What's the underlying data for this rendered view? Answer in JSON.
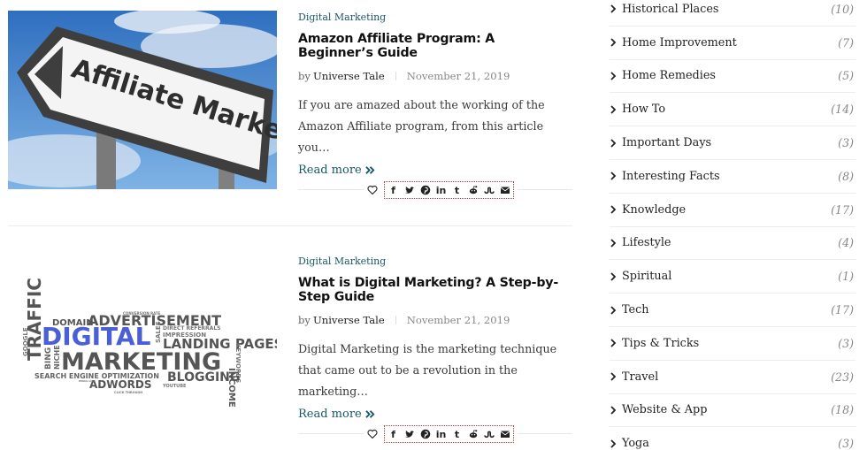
{
  "posts": [
    {
      "category": "Digital Marketing",
      "title": "Amazon Affiliate Program: A Beginner’s Guide",
      "by": "by",
      "author": "Universe Tale",
      "date": "November 21, 2019",
      "excerpt": "If you are amazed about the working of the Amazon Affiliate program, from this article you…",
      "read_more": "Read more",
      "image_sign_text": "Affiliate Marketing"
    },
    {
      "category": "Digital Marketing",
      "title": "What is Digital Marketing? A Step-by-Step Guide",
      "by": "by",
      "author": "Universe Tale",
      "date": "November 21, 2019",
      "excerpt": "Digital Marketing is the marketing technique that came out to be a revolution in the marketing…",
      "read_more": "Read more",
      "wordcloud": {
        "domain": "DOMAIN",
        "advertisement": "ADVERTISEMENT",
        "conversion_rate": "CONVERSION RATE",
        "traffic": "TRAFFIC",
        "digital": "DIGITAL",
        "sales": "SALES",
        "direct_referrals": "DIRECT REFERRALS",
        "impression": "IMPRESSION",
        "landing_pages": "LANDING PAGES",
        "google": "GOOGLE",
        "bing": "BING",
        "niche": "NICHE",
        "marketing": "MARKETING",
        "keywords": "KEYWORDS",
        "search_engine": "SEARCH ENGINE OPTIMIZATION",
        "blogging": "BLOGGING",
        "income": "INCOME",
        "adwords": "ADWORDS",
        "youtube": "YOUTUBE",
        "email_list": "EMAIL LIST",
        "click_through": "CLICK THROUGH"
      }
    }
  ],
  "share_icons": [
    "like-heart",
    "facebook",
    "twitter",
    "pinterest",
    "linkedin",
    "tumblr",
    "reddit",
    "stumbleupon",
    "email"
  ],
  "share_glyphs": {
    "facebook": "f",
    "linkedin": "in",
    "tumblr": "t"
  },
  "sidebar": {
    "categories": [
      {
        "label": "Historical Places",
        "count": "(10)"
      },
      {
        "label": "Home Improvement",
        "count": "(7)"
      },
      {
        "label": "Home Remedies",
        "count": "(5)"
      },
      {
        "label": "How To",
        "count": "(14)"
      },
      {
        "label": "Important Days",
        "count": "(3)"
      },
      {
        "label": "Interesting Facts",
        "count": "(8)"
      },
      {
        "label": "Knowledge",
        "count": "(17)"
      },
      {
        "label": "Lifestyle",
        "count": "(4)"
      },
      {
        "label": "Spiritual",
        "count": "(1)"
      },
      {
        "label": "Tech",
        "count": "(17)"
      },
      {
        "label": "Tips & Tricks",
        "count": "(3)"
      },
      {
        "label": "Travel",
        "count": "(23)"
      },
      {
        "label": "Website & App",
        "count": "(18)"
      },
      {
        "label": "Yoga",
        "count": "(3)"
      }
    ]
  },
  "colors": {
    "accent": "#18566b",
    "share_border": "#c03b3b",
    "wordcloud_blue": "#4a5fd6"
  }
}
